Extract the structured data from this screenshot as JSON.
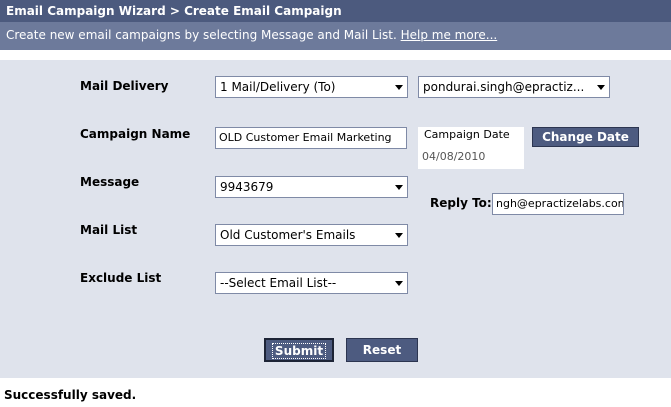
{
  "header": {
    "title": "Email Campaign Wizard > Create Email Campaign",
    "subtitle": "Create new email campaigns by selecting Message and Mail List.",
    "help_link": "Help me more..."
  },
  "form": {
    "mail_delivery": {
      "label": "Mail Delivery",
      "selected": "1 Mail/Delivery (To)",
      "from_selected": "pondurai.singh@epractiz..."
    },
    "campaign_name": {
      "label": "Campaign Name",
      "value": "OLD Customer Email Marketing"
    },
    "campaign_date": {
      "label": "Campaign Date",
      "value": "04/08/2010",
      "change_button": "Change Date"
    },
    "message": {
      "label": "Message",
      "selected": "9943679"
    },
    "reply_to": {
      "label": "Reply To:",
      "value": "ngh@epractizelabs.com"
    },
    "mail_list": {
      "label": "Mail List",
      "selected": "Old Customer's Emails"
    },
    "exclude_list": {
      "label": "Exclude List",
      "selected": "--Select Email List--"
    }
  },
  "buttons": {
    "submit": "Submit",
    "reset": "Reset"
  },
  "status": "Successfully saved.",
  "colors": {
    "titlebar": "#4c5a7e",
    "subtitlebar": "#6d7a9b",
    "form_background": "#dfe3ec",
    "button": "#4d5b80"
  }
}
